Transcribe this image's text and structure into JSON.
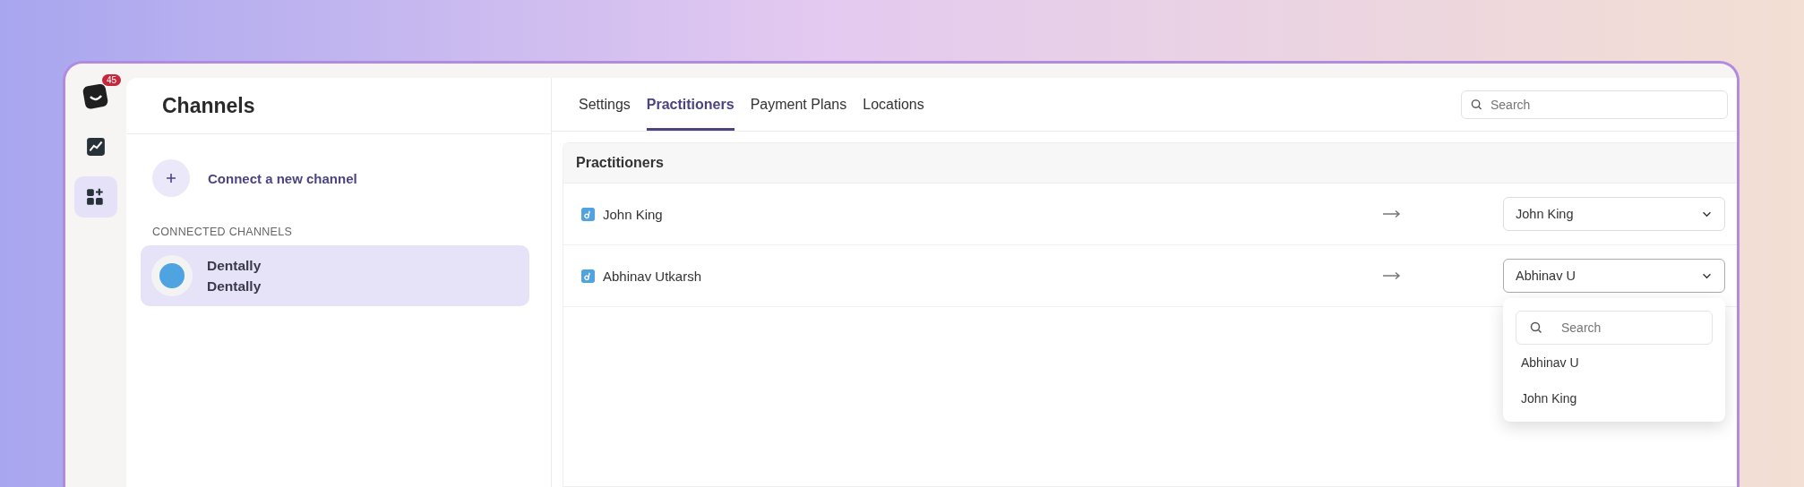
{
  "rail": {
    "badge": "45",
    "items": [
      {
        "kind": "chart",
        "selected": false
      },
      {
        "kind": "apps",
        "selected": true
      }
    ]
  },
  "channels": {
    "title": "Channels",
    "connect_label": "Connect a new channel",
    "section_label": "CONNECTED CHANNELS",
    "items": [
      {
        "name": "Dentally",
        "subtitle": "Dentally",
        "selected": true
      }
    ]
  },
  "tabs": [
    {
      "label": "Settings",
      "selected": false
    },
    {
      "label": "Practitioners",
      "selected": true
    },
    {
      "label": "Payment Plans",
      "selected": false
    },
    {
      "label": "Locations",
      "selected": false
    }
  ],
  "search": {
    "placeholder": "Search"
  },
  "section": {
    "title": "Practitioners",
    "rows": [
      {
        "name": "John King",
        "value": "John King",
        "open": false
      },
      {
        "name": "Abhinav Utkarsh",
        "value": "Abhinav U",
        "open": true
      }
    ]
  },
  "dropdown": {
    "placeholder": "Search",
    "options": [
      "Abhinav U",
      "John King"
    ]
  }
}
